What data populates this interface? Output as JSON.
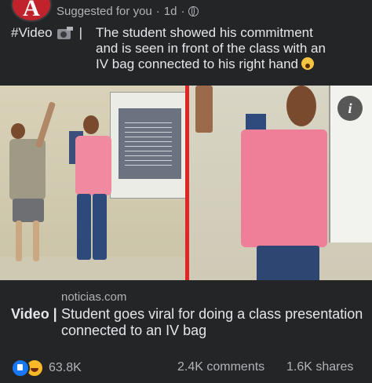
{
  "post": {
    "suggested": "Suggested for you",
    "dot1": "·",
    "time": "1d",
    "dot2": "·",
    "hashtag": "#Video",
    "separator": "|",
    "caption_line1": "The student showed his commitment",
    "caption_line2": "and is seen in front of the class with an",
    "caption_line3": "IV bag connected to his right hand"
  },
  "media": {
    "info_label": "i"
  },
  "link": {
    "domain": "noticias.com",
    "tag": "Video |",
    "title": "Student goes viral for doing a class presentation connected to an IV bag"
  },
  "engagement": {
    "reaction_count": "63.8K",
    "comments": "2.4K comments",
    "shares": "1.6K shares"
  },
  "colors": {
    "background": "#242526",
    "divider": "#e02525",
    "like": "#1877f2",
    "haha": "#f7b928",
    "avatar": "#c0232b"
  }
}
